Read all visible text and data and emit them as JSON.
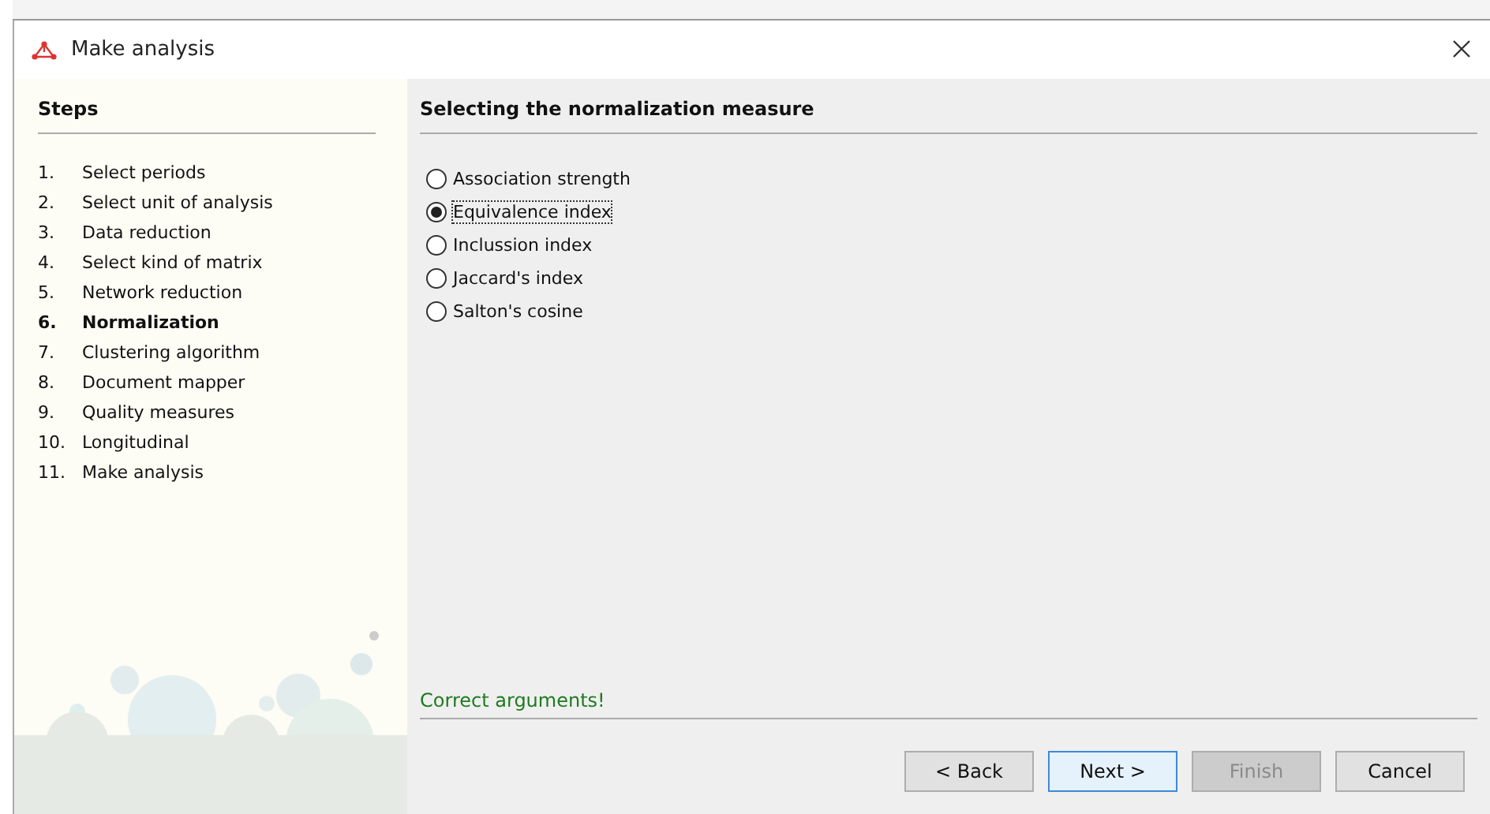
{
  "window": {
    "title": "Make analysis"
  },
  "steps": {
    "title": "Steps",
    "items": [
      {
        "number": "1.",
        "label": "Select periods",
        "selected": false
      },
      {
        "number": "2.",
        "label": "Select unit of analysis",
        "selected": false
      },
      {
        "number": "3.",
        "label": "Data reduction",
        "selected": false
      },
      {
        "number": "4.",
        "label": "Select kind of matrix",
        "selected": false
      },
      {
        "number": "5.",
        "label": "Network reduction",
        "selected": false
      },
      {
        "number": "6.",
        "label": "Normalization",
        "selected": true
      },
      {
        "number": "7.",
        "label": "Clustering algorithm",
        "selected": false
      },
      {
        "number": "8.",
        "label": "Document mapper",
        "selected": false
      },
      {
        "number": "9.",
        "label": "Quality measures",
        "selected": false
      },
      {
        "number": "10.",
        "label": "Longitudinal",
        "selected": false
      },
      {
        "number": "11.",
        "label": "Make analysis",
        "selected": false
      }
    ]
  },
  "content": {
    "title": "Selecting the normalization measure",
    "options": [
      {
        "label": "Association strength",
        "selected": false
      },
      {
        "label": "Equivalence index",
        "selected": true
      },
      {
        "label": "Inclussion index",
        "selected": false
      },
      {
        "label": "Jaccard's index",
        "selected": false
      },
      {
        "label": "Salton's cosine",
        "selected": false
      }
    ],
    "status": "Correct arguments!"
  },
  "buttons": [
    {
      "label": "< Back",
      "disabled": false,
      "default": false
    },
    {
      "label": "Next >",
      "disabled": false,
      "default": true
    },
    {
      "label": "Finish",
      "disabled": true,
      "default": false
    },
    {
      "label": "Cancel",
      "disabled": false,
      "default": false
    }
  ]
}
